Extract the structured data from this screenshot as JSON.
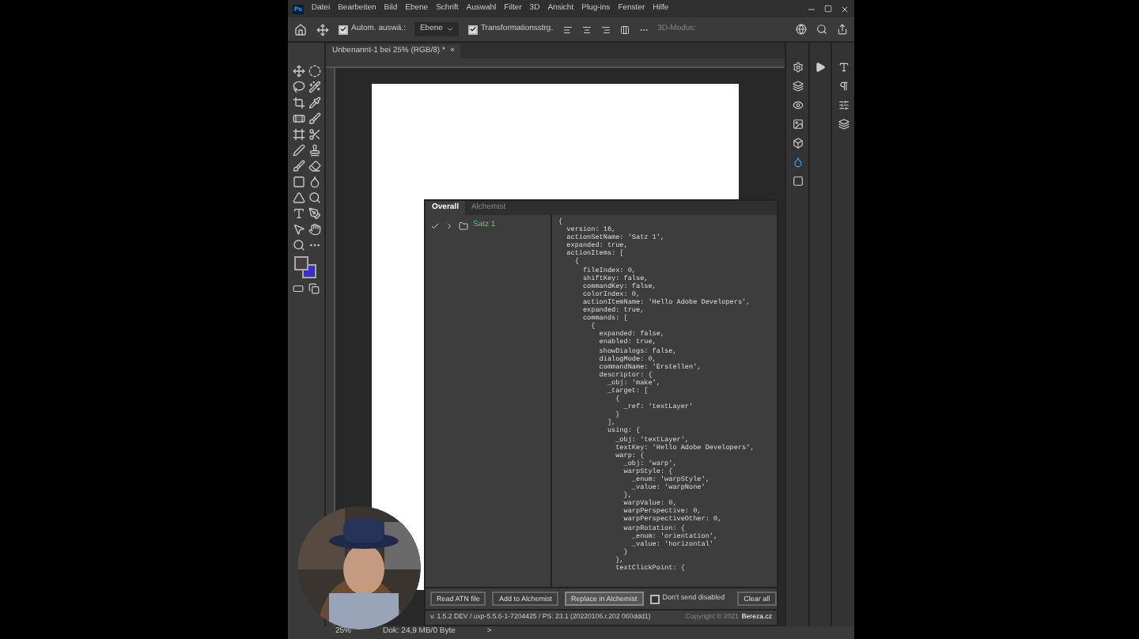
{
  "app_badge": "Ps",
  "menu": [
    "Datei",
    "Bearbeiten",
    "Bild",
    "Ebene",
    "Schrift",
    "Auswahl",
    "Filter",
    "3D",
    "Ansicht",
    "Plug-ins",
    "Fenster",
    "Hilfe"
  ],
  "options_bar": {
    "auto_select": {
      "label": "Autom. auswä.:",
      "checked": true
    },
    "auto_select_target": "Ebene",
    "transform_controls": {
      "label": "Transformationsstrg.",
      "checked": true
    },
    "mode_3d": "3D-Modus:"
  },
  "document_tab": {
    "title": "Unbenannt-1 bei 25% (RGB/8) *",
    "close": "×"
  },
  "plugin_panel": {
    "tabs": [
      {
        "label": "Overall",
        "selected": true
      },
      {
        "label": "Alchemist",
        "selected": false
      }
    ],
    "tree": [
      {
        "label": "Satz 1",
        "checked": true,
        "expanded": false
      }
    ],
    "code": "{\n  version: 16,\n  actionSetName: 'Satz 1',\n  expanded: true,\n  actionItems: [\n    {\n      fileIndex: 0,\n      shiftKey: false,\n      commandKey: false,\n      colorIndex: 0,\n      actionItemName: 'Hello Adobe Developers',\n      expanded: true,\n      commands: [\n        {\n          expanded: false,\n          enabled: true,\n          showDialogs: false,\n          dialogMode: 0,\n          commandName: 'Erstellen',\n          descriptor: {\n            _obj: 'make',\n            _target: [\n              {\n                _ref: 'textLayer'\n              }\n            ],\n            using: {\n              _obj: 'textLayer',\n              textKey: 'Hello Adobe Developers',\n              warp: {\n                _obj: 'warp',\n                warpStyle: {\n                  _enum: 'warpStyle',\n                  _value: 'warpNone'\n                },\n                warpValue: 0,\n                warpPerspective: 0,\n                warpPerspectiveOther: 0,\n                warpRotation: {\n                  _enum: 'orientation',\n                  _value: 'horizontal'\n                }\n              },\n              textClickPoint: {",
    "buttons": [
      {
        "label": "Read ATN file",
        "selected": false
      },
      {
        "label": "Add to Alchemist",
        "selected": false
      },
      {
        "label": "Replace in Alchemist",
        "selected": true
      }
    ],
    "dont_send_disabled": {
      "label": "Don't send disabled",
      "checked": false
    },
    "clear_button": "Clear all",
    "version": "v. 1.5.2 DEV / uxp-5.5.6-1-7204425 / PS: 23.1 (20220106.r.202 060ddd1)",
    "copyright": "Copyright © 2021",
    "copyright_link": "Bereza.cz"
  },
  "status_bar": {
    "zoom": "25%",
    "doc_size": "Dok: 24,9 MB/0 Byte",
    "arrow": ">"
  }
}
